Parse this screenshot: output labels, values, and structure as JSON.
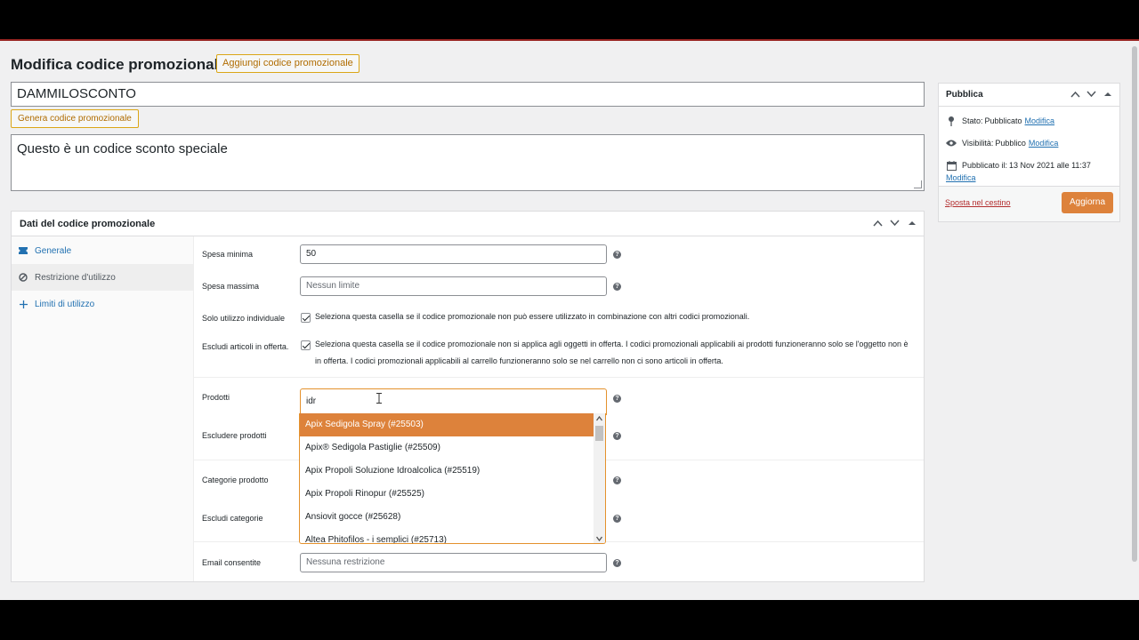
{
  "header": {
    "page_title": "Modifica codice promozionale",
    "add_button": "Aggiungi codice promozionale"
  },
  "coupon": {
    "code": "DAMMILOSCONTO",
    "generate_button": "Genera codice promozionale",
    "description": "Questo è un codice sconto speciale"
  },
  "coupon_data": {
    "title": "Dati del codice promozionale",
    "tabs": [
      {
        "label": "Generale",
        "icon": "ticket-icon",
        "active": false
      },
      {
        "label": "Restrizione d'utilizzo",
        "icon": "prohibited-icon",
        "active": true
      },
      {
        "label": "Limiti di utilizzo",
        "icon": "plus-icon",
        "active": false
      }
    ],
    "fields": {
      "min_spend": {
        "label": "Spesa minima",
        "value": "50"
      },
      "max_spend": {
        "label": "Spesa massima",
        "placeholder": "Nessun limite"
      },
      "individual_use": {
        "label": "Solo utilizzo individuale",
        "text": "Seleziona questa casella se il codice promozionale non può essere utilizzato in combinazione con altri codici promozionali.",
        "checked": true
      },
      "exclude_sale": {
        "label": "Escludi articoli in offerta.",
        "text": "Seleziona questa casella se il codice promozionale non si applica agli oggetti in offerta. I codici promozionali applicabili ai prodotti funzioneranno solo se l'oggetto non è in offerta. I codici promozionali applicabili al carrello funzioneranno solo se nel carrello non ci sono articoli in offerta.",
        "checked": true
      },
      "products": {
        "label": "Prodotti",
        "search": "idr"
      },
      "exclude_products": {
        "label": "Escludere prodotti"
      },
      "product_categories": {
        "label": "Categorie prodotto"
      },
      "exclude_categories": {
        "label": "Escludi categorie"
      },
      "allowed_emails": {
        "label": "Email consentite",
        "placeholder": "Nessuna restrizione"
      }
    },
    "dropdown_options": [
      "Apix Sedigola Spray (#25503)",
      "Apix® Sedigola Pastiglie (#25509)",
      "Apix Propoli Soluzione Idroalcolica (#25519)",
      "Apix Propoli Rinopur (#25525)",
      "Ansiovit gocce (#25628)",
      "Altea Phitofilos - i semplici (#25713)"
    ]
  },
  "publish": {
    "title": "Pubblica",
    "status_label": "Stato:",
    "status_value": "Pubblicato",
    "visibility_label": "Visibilità:",
    "visibility_value": "Pubblico",
    "published_label": "Pubblicato il:",
    "published_value": "13 Nov 2021 alle 11:37",
    "edit_link": "Modifica",
    "trash_link": "Sposta nel cestino",
    "update_button": "Aggiorna"
  },
  "colors": {
    "accent": "#dd823b",
    "link": "#2271b1",
    "danger": "#b32d2e"
  }
}
